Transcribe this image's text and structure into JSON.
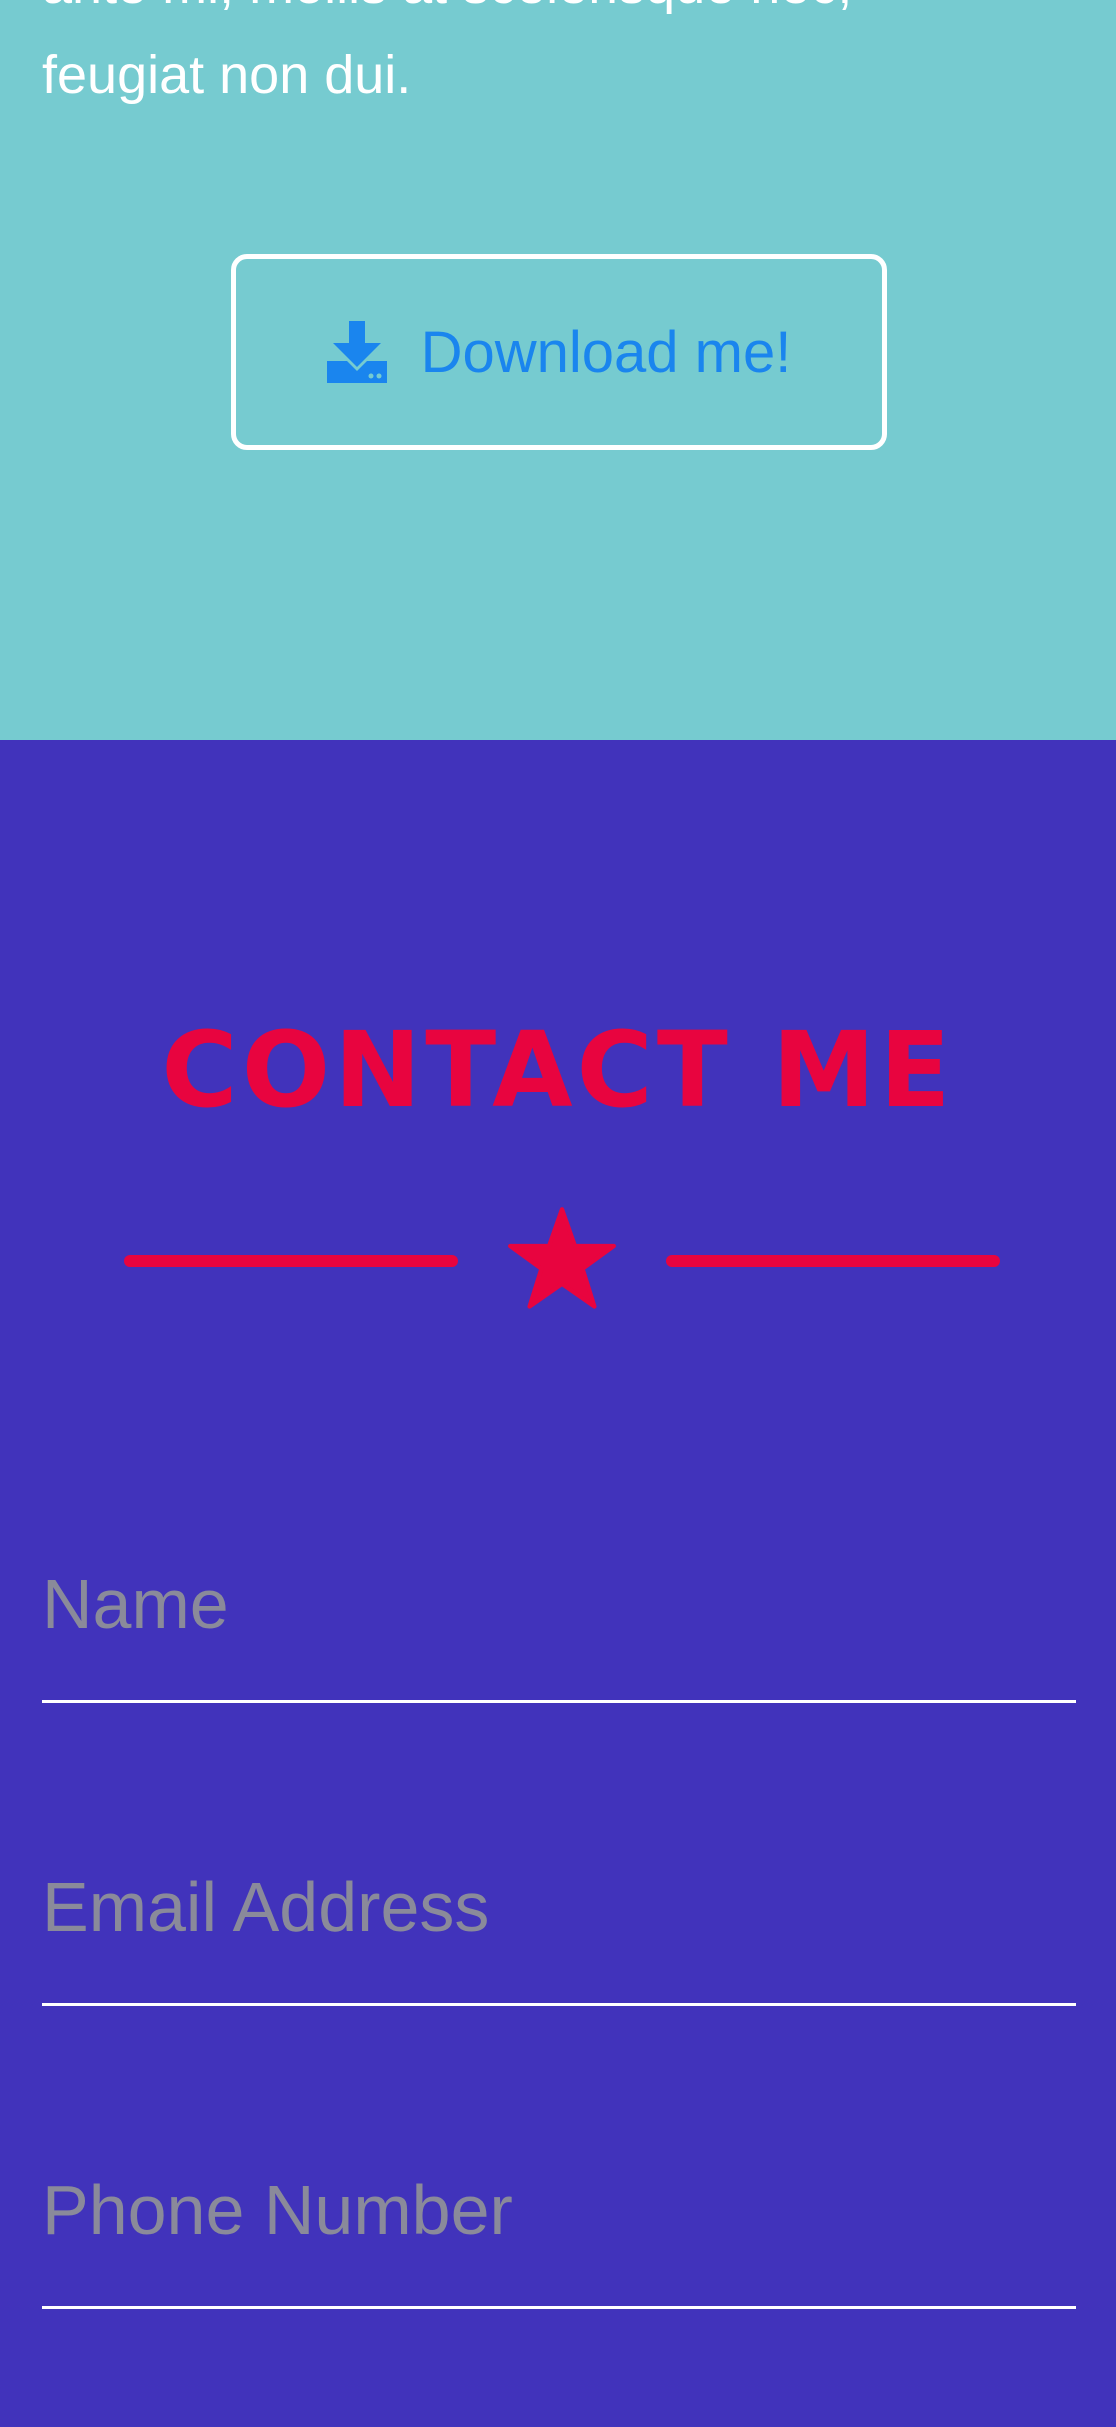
{
  "about": {
    "text_lines": [
      "ante mi, mollis at scelerisque nec,",
      "feugiat non dui."
    ],
    "download_button": {
      "label": "Download me!",
      "icon": "download-icon"
    }
  },
  "contact": {
    "title": "CONTACT ME",
    "divider_icon": "star-icon",
    "fields": {
      "name": {
        "placeholder": "Name",
        "value": ""
      },
      "email": {
        "placeholder": "Email Address",
        "value": ""
      },
      "phone": {
        "placeholder": "Phone Number",
        "value": ""
      }
    }
  },
  "colors": {
    "about_bg": "#76cbd0",
    "contact_bg": "#4133bb",
    "accent": "#e8043f",
    "button_text": "#1a85ee",
    "placeholder": "#8a8a9a"
  }
}
